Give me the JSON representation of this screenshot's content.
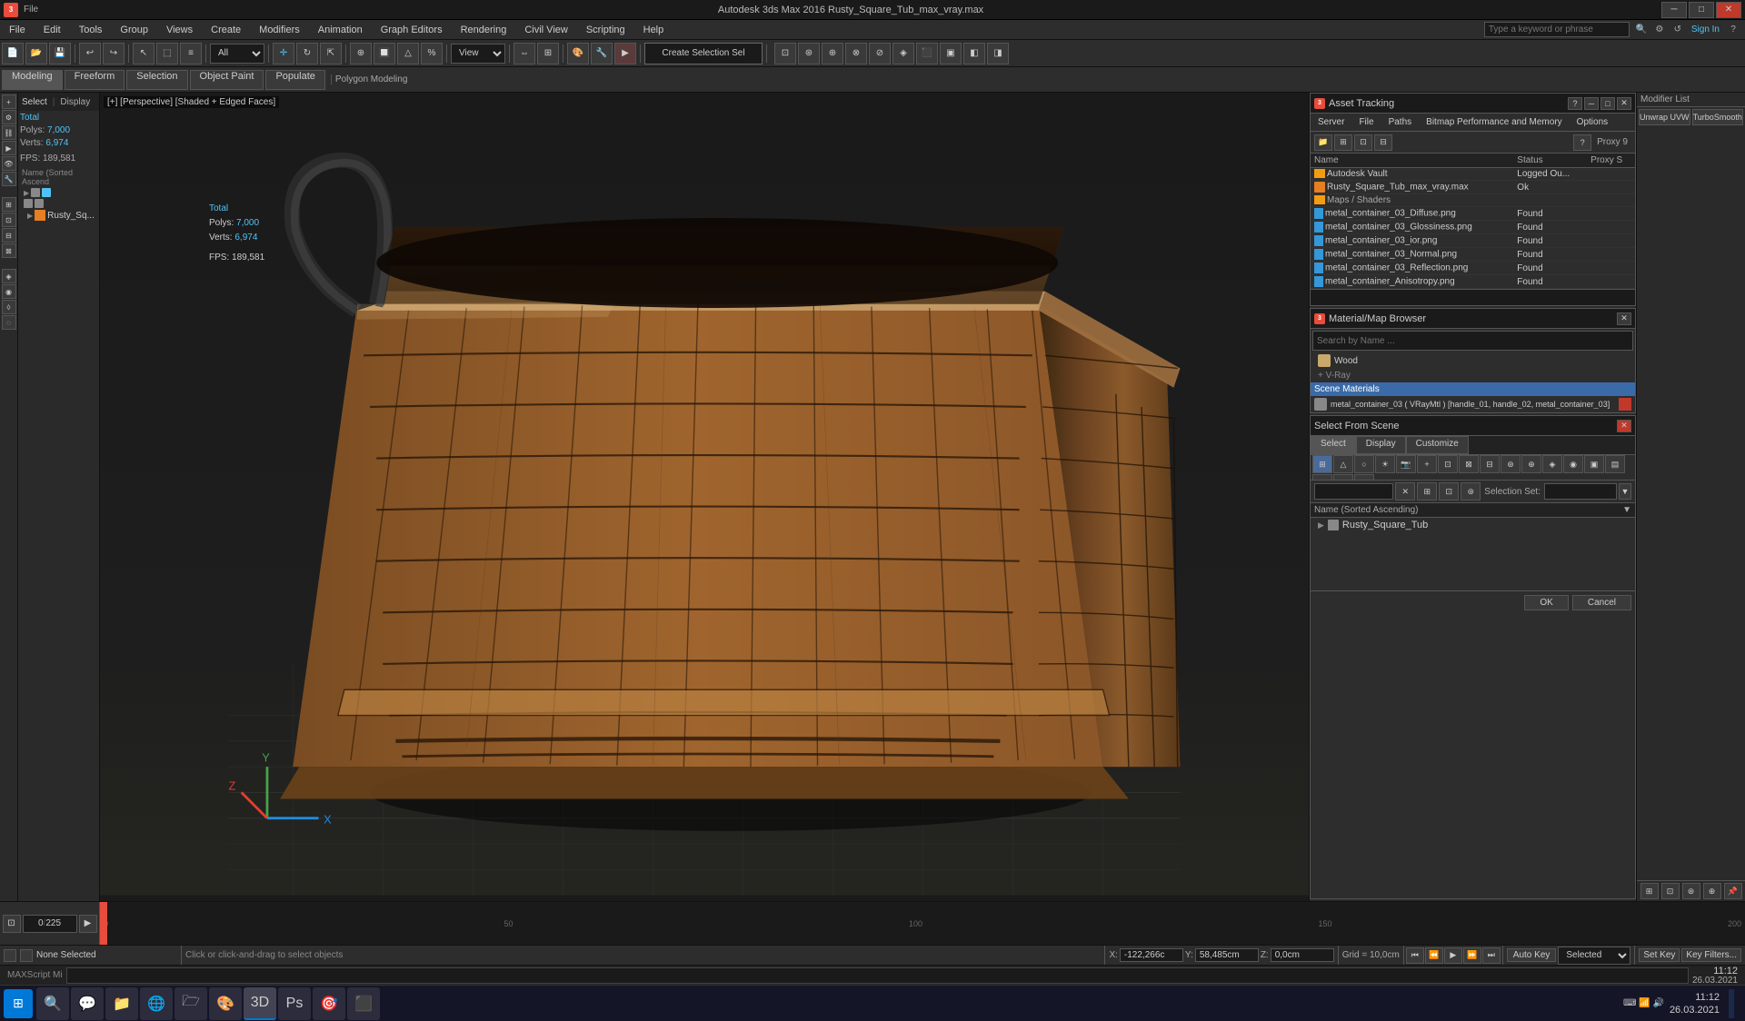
{
  "titlebar": {
    "app_name": "Autodesk 3ds Max 2016",
    "file_name": "Rusty_Square_Tub_max_vray.max",
    "full_title": "Autodesk 3ds Max 2016  Rusty_Square_Tub_max_vray.max",
    "min_label": "─",
    "max_label": "□",
    "close_label": "✕"
  },
  "menu": {
    "items": [
      "File",
      "Edit",
      "Tools",
      "Group",
      "Views",
      "Create",
      "Modifiers",
      "Animation",
      "Graph Editors",
      "Rendering",
      "Civil View",
      "Scripting",
      "Help"
    ]
  },
  "toolbar": {
    "undo_label": "↩",
    "redo_label": "↪",
    "select_label": "↖",
    "move_label": "✛",
    "rotate_label": "↻",
    "scale_label": "⇱",
    "filter_label": "All",
    "view_label": "View",
    "create_sel_label": "Create Selection Sel",
    "search_placeholder": "Type a keyword or phrase",
    "sign_in": "Sign In"
  },
  "toolbar2": {
    "tabs": [
      "Modeling",
      "Freeform",
      "Selection",
      "Object Paint",
      "Populate"
    ]
  },
  "sub_label": "Polygon Modeling",
  "scene_panel": {
    "header_select": "Select",
    "header_display": "Display",
    "stats_total_label": "Total",
    "polys_label": "Polys:",
    "polys_value": "7,000",
    "verts_label": "Verts:",
    "verts_value": "6,974",
    "fps_label": "FPS:",
    "fps_value": "189,581",
    "tree_items": [
      {
        "label": "Name (Sorted Ascend",
        "indent": 0
      },
      {
        "label": "",
        "indent": 1,
        "icon": true
      },
      {
        "label": "",
        "indent": 1,
        "icon": true
      },
      {
        "label": "Rusty_Sq...",
        "indent": 2,
        "icon": true
      }
    ]
  },
  "viewport": {
    "label": "[+] [Perspective] [Shaded + Edged Faces]"
  },
  "asset_tracking": {
    "title": "Asset Tracking",
    "menus": [
      "Server",
      "File",
      "Paths",
      "Bitmap Performance and Memory",
      "Options"
    ],
    "columns": [
      "Name",
      "Status",
      "Proxy S"
    ],
    "rows": [
      {
        "name": "Autodesk Vault",
        "status": "Logged Ou...",
        "indent": 0,
        "type": "vault"
      },
      {
        "name": "Rusty_Square_Tub_max_vray.max",
        "status": "Ok",
        "indent": 1,
        "type": "file"
      },
      {
        "name": "Maps / Shaders",
        "status": "",
        "indent": 2,
        "type": "folder"
      },
      {
        "name": "metal_container_03_Diffuse.png",
        "status": "Found",
        "indent": 3,
        "type": "image"
      },
      {
        "name": "metal_container_03_Glossiness.png",
        "status": "Found",
        "indent": 3,
        "type": "image"
      },
      {
        "name": "metal_container_03_ior.png",
        "status": "Found",
        "indent": 3,
        "type": "image"
      },
      {
        "name": "metal_container_03_Normal.png",
        "status": "Found",
        "indent": 3,
        "type": "image"
      },
      {
        "name": "metal_container_03_Reflection.png",
        "status": "Found",
        "indent": 3,
        "type": "image"
      },
      {
        "name": "metal_container_Anisotropy.png",
        "status": "Found",
        "indent": 3,
        "type": "image"
      }
    ]
  },
  "material_browser": {
    "title": "Material/Map Browser",
    "search_placeholder": "Search by Name ...",
    "items": [
      {
        "name": "Wood",
        "type": "material"
      },
      {
        "name": "+ V-Ray",
        "type": "expand"
      }
    ],
    "scene_section": "Scene Materials",
    "scene_items": [
      {
        "name": "metal_container_03  ( VRayMtl )  [handle_01, handle_02, metal_container_03]",
        "has_swatch": true
      }
    ]
  },
  "select_from_scene": {
    "title": "Select From Scene",
    "tabs": [
      "Select",
      "Display",
      "Customize"
    ],
    "selection_set_label": "Selection Set:",
    "column_label": "Name (Sorted Ascending)",
    "tree_items": [
      {
        "name": "Rusty_Square_Tub",
        "indent": 0,
        "expanded": true
      }
    ],
    "ok_label": "OK",
    "cancel_label": "Cancel"
  },
  "status_bar": {
    "none_selected": "None Selected",
    "hint": "Click or click-and-drag to select objects",
    "x_label": "X:",
    "x_value": "-122,266c",
    "y_label": "Y:",
    "y_value": "58,485cm",
    "z_label": "Z:",
    "z_value": "0,0cm",
    "grid_label": "Grid = 10,0cm",
    "auto_key": "Auto Key",
    "set_key": "Set Key",
    "key_filters": "Key Filters...",
    "selected_label": "Selected",
    "time": "11:12",
    "date": "26.03.2021"
  },
  "timeline": {
    "frame_current": "0",
    "frame_total": "225",
    "labels": [
      "0",
      "50",
      "100",
      "150",
      "200"
    ]
  },
  "proxy_label": "Proxy 9",
  "taskbar": {
    "icons": [
      "⊞",
      "🔍",
      "💬",
      "📁",
      "🌐",
      "🗁",
      "🎨",
      "🐘",
      "3D",
      "🎯"
    ],
    "time": "11:12",
    "date": "26.03.2021"
  }
}
